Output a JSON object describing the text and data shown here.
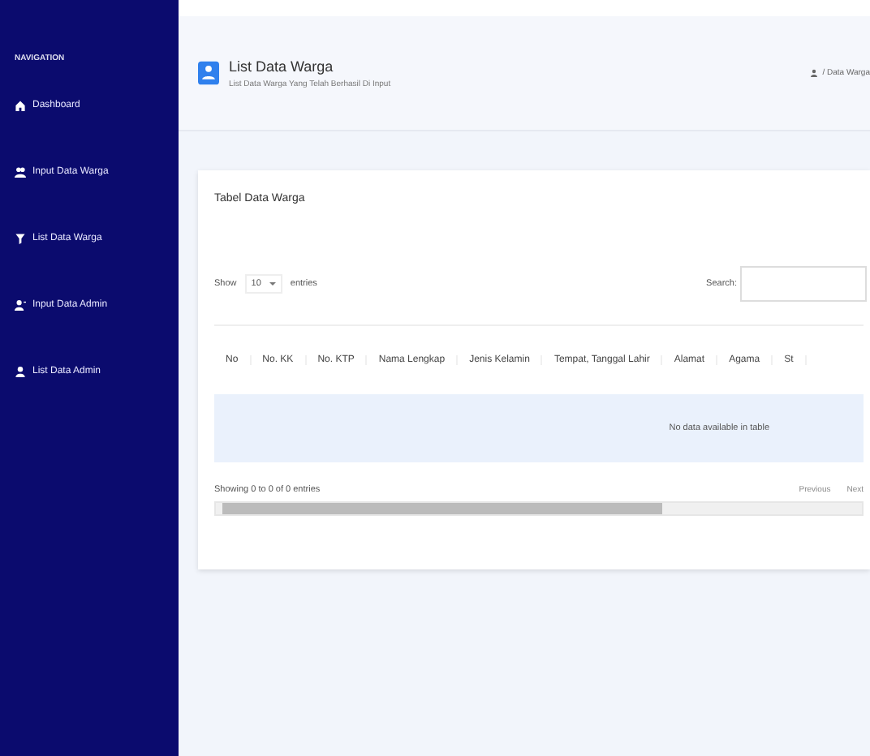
{
  "sidebar": {
    "heading": "NAVIGATION",
    "items": [
      {
        "label": "Dashboard"
      },
      {
        "label": "Input Data Warga"
      },
      {
        "label": "List Data Warga"
      },
      {
        "label": "Input Data Admin"
      },
      {
        "label": "List Data Admin"
      }
    ]
  },
  "header": {
    "title": "List Data Warga",
    "subtitle": "List Data Warga Yang Telah Berhasil Di Input",
    "breadcrumb": "/ Data Warga"
  },
  "card": {
    "title": "Tabel Data Warga",
    "show_label": "Show",
    "page_size": "10",
    "entries_label": "entries",
    "search_label": "Search:",
    "columns": [
      "No",
      "No. KK",
      "No. KTP",
      "Nama Lengkap",
      "Jenis Kelamin",
      "Tempat, Tanggal Lahir",
      "Alamat",
      "Agama",
      "St"
    ],
    "empty_message": "No data available in table",
    "info": "Showing 0 to 0 of 0 entries",
    "pagination": [
      "Previous",
      "Next"
    ]
  }
}
